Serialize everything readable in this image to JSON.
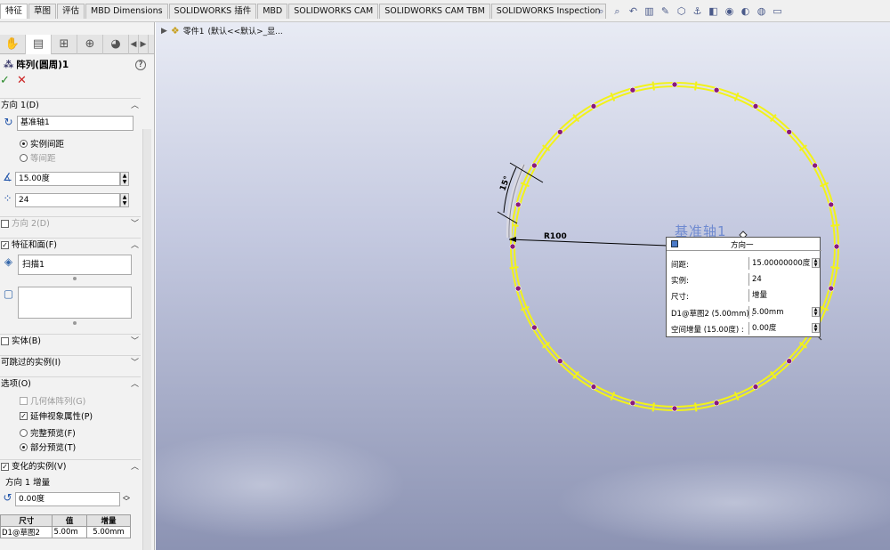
{
  "tabs": [
    "特征",
    "草图",
    "评估",
    "MBD Dimensions",
    "SOLIDWORKS 插件",
    "MBD",
    "SOLIDWORKS CAM",
    "SOLIDWORKS CAM TBM",
    "SOLIDWORKS Inspection"
  ],
  "view_icons": [
    "zoom-to-fit-icon",
    "zoom-area-icon",
    "previous-view-icon",
    "section-view-icon",
    "dynamic-annotation-icon",
    "view-orientation-icon",
    "display-style-icon",
    "hide-show-icon",
    "edit-appearance-icon",
    "apply-scene-icon",
    "view-settings-icon",
    "display-icon"
  ],
  "panel": {
    "title": "阵列(圆周)1",
    "help": "?",
    "ok": "✓",
    "cancel": "✕",
    "direction1": {
      "label": "方向 1(D)",
      "axis_value": "基准轴1",
      "option_instance_spacing": "实例间距",
      "option_equal_spacing": "等间距",
      "angle_value": "15.00度",
      "count_value": "24"
    },
    "direction2": {
      "label": "方向 2(D)"
    },
    "features_faces": {
      "label": "特征和面(F)",
      "feature_item": "扫描1"
    },
    "bodies": {
      "label": "实体(B)"
    },
    "skip_instances": {
      "label": "可跳过的实例(I)"
    },
    "options": {
      "label": "选项(O)",
      "geometry_pattern": "几何体阵列(G)",
      "propagate_visual": "延伸视象属性(P)",
      "full_preview": "完整预览(F)",
      "partial_preview": "部分预览(T)"
    },
    "varied_instances": {
      "label": "变化的实例(V)",
      "direction1_increment": "方向 1 增量",
      "angle_increment": "0.00度",
      "table_headers": [
        "尺寸",
        "值",
        "增量"
      ],
      "table_rows": [
        [
          "D1@草图2",
          "5.00m",
          "5.00mm"
        ]
      ]
    }
  },
  "graphics": {
    "tree_label": "零件1",
    "tree_config": "(默认<<默认>_显...",
    "dimension_radius": "R100",
    "dimension_angle": "15°",
    "callout": {
      "title": "基准轴1",
      "header": "方向一",
      "rows": [
        {
          "key": "间距:",
          "value": "15.00000000度"
        },
        {
          "key": "实例:",
          "value": "24"
        },
        {
          "key": "尺寸:",
          "value": "增量"
        },
        {
          "key": "D1@草图2 (5.00mm) :",
          "value": "5.00mm"
        },
        {
          "key": "空间增量 (15.00度) :",
          "value": "0.00度"
        }
      ]
    }
  },
  "colors": {
    "pattern_yellow": "#f2f21a",
    "marker_purple": "#8a1a7a",
    "annotation_red": "#e01818"
  }
}
